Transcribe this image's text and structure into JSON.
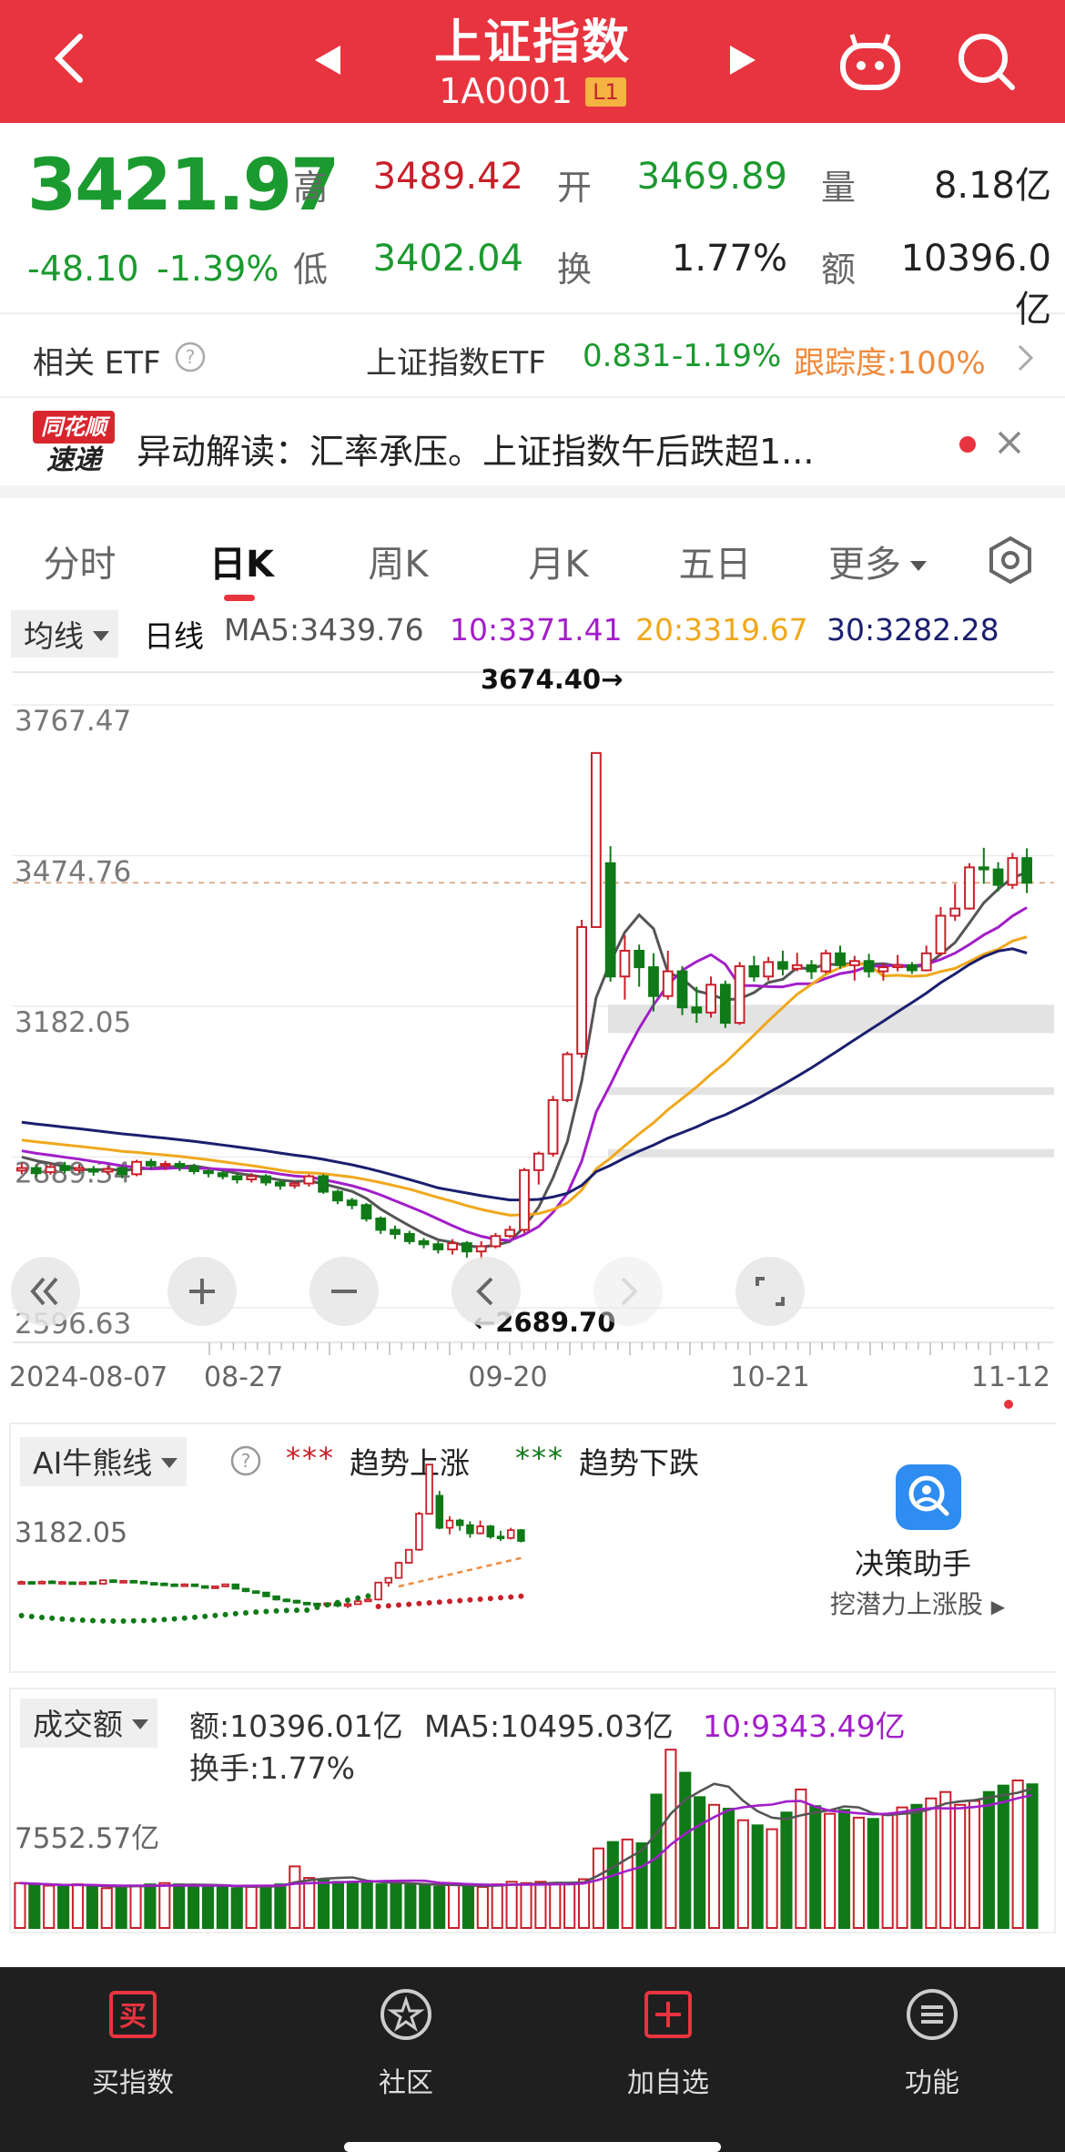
{
  "header": {
    "title": "上证指数",
    "code": "1A0001",
    "level_badge": "L1"
  },
  "quote": {
    "price": "3421.97",
    "change": "-48.10",
    "change_pct": "-1.39%",
    "high_label": "高",
    "high_value": "3489.42",
    "open_label": "开",
    "open_value": "3469.89",
    "volume_label": "量",
    "volume_value": "8.18亿",
    "low_label": "低",
    "low_value": "3402.04",
    "turnover_label": "换",
    "turnover_value": "1.77%",
    "amount_label": "额",
    "amount_value": "10396.0亿"
  },
  "etf": {
    "label": "相关 ETF",
    "name": "上证指数ETF",
    "price": "0.831",
    "change": "-1.19%",
    "tracking": "跟踪度:100%"
  },
  "news": {
    "logo_top": "同花顺",
    "logo_bottom": "速递",
    "text": "异动解读：汇率承压。上证指数午后跌超1..."
  },
  "tabs": [
    "分时",
    "日K",
    "周K",
    "月K",
    "五日",
    "更多"
  ],
  "ma_bar": {
    "selector": "均线",
    "period": "日线",
    "ma5": "MA5:3439.76",
    "ma10": "10:3371.41",
    "ma20": "20:3319.67",
    "ma30": "30:3282.28"
  },
  "colors": {
    "up": "#c8202a",
    "down": "#0f7a17",
    "ma5": "#555555",
    "ma10": "#a21ec9",
    "ma20": "#f0a81c",
    "ma30": "#1b1f6e"
  },
  "chart_data": {
    "type": "candlestick",
    "y_ticks": [
      "3767.47",
      "3474.76",
      "3182.05",
      "2889.34",
      "2596.63"
    ],
    "ylim": [
      2596.63,
      3767.47
    ],
    "x_labels": [
      "2024-08-07",
      "08-27",
      "09-20",
      "10-21",
      "11-12"
    ],
    "annotation_high": "3674.40→",
    "annotation_low": "←2689.70",
    "dashed_price": 3421.97,
    "candles": [
      [
        2863,
        2868,
        2878,
        2856
      ],
      [
        2868,
        2858,
        2874,
        2850
      ],
      [
        2860,
        2870,
        2878,
        2855
      ],
      [
        2872,
        2864,
        2880,
        2858
      ],
      [
        2864,
        2868,
        2875,
        2858
      ],
      [
        2866,
        2861,
        2872,
        2853
      ],
      [
        2861,
        2866,
        2872,
        2855
      ],
      [
        2868,
        2856,
        2872,
        2848
      ],
      [
        2856,
        2880,
        2884,
        2852
      ],
      [
        2880,
        2873,
        2886,
        2866
      ],
      [
        2873,
        2876,
        2882,
        2864
      ],
      [
        2876,
        2870,
        2882,
        2862
      ],
      [
        2870,
        2862,
        2876,
        2856
      ],
      [
        2862,
        2858,
        2866,
        2850
      ],
      [
        2858,
        2852,
        2864,
        2846
      ],
      [
        2852,
        2846,
        2858,
        2838
      ],
      [
        2846,
        2852,
        2858,
        2840
      ],
      [
        2852,
        2840,
        2856,
        2834
      ],
      [
        2840,
        2834,
        2846,
        2826
      ],
      [
        2834,
        2838,
        2844,
        2828
      ],
      [
        2838,
        2852,
        2856,
        2832
      ],
      [
        2852,
        2822,
        2856,
        2818
      ],
      [
        2822,
        2805,
        2826,
        2798
      ],
      [
        2805,
        2796,
        2810,
        2788
      ],
      [
        2796,
        2770,
        2800,
        2764
      ],
      [
        2770,
        2748,
        2774,
        2740
      ],
      [
        2748,
        2740,
        2756,
        2730
      ],
      [
        2740,
        2726,
        2746,
        2720
      ],
      [
        2726,
        2720,
        2732,
        2712
      ],
      [
        2720,
        2710,
        2726,
        2702
      ],
      [
        2710,
        2722,
        2730,
        2700
      ],
      [
        2722,
        2706,
        2726,
        2694
      ],
      [
        2706,
        2716,
        2726,
        2690
      ],
      [
        2716,
        2736,
        2742,
        2712
      ],
      [
        2736,
        2748,
        2756,
        2732
      ],
      [
        2748,
        2864,
        2868,
        2742
      ],
      [
        2864,
        2896,
        2900,
        2836
      ],
      [
        2896,
        3000,
        3008,
        2890
      ],
      [
        3000,
        3089,
        3094,
        2996
      ],
      [
        3090,
        3336,
        3350,
        3082
      ],
      [
        3336,
        3674,
        3674,
        3336
      ],
      [
        3460,
        3240,
        3493,
        3230
      ],
      [
        3240,
        3290,
        3320,
        3195
      ],
      [
        3290,
        3258,
        3302,
        3220
      ],
      [
        3258,
        3202,
        3285,
        3172
      ],
      [
        3202,
        3250,
        3290,
        3195
      ],
      [
        3250,
        3180,
        3260,
        3165
      ],
      [
        3180,
        3170,
        3220,
        3150
      ],
      [
        3170,
        3224,
        3240,
        3160
      ],
      [
        3224,
        3150,
        3232,
        3140
      ],
      [
        3150,
        3260,
        3268,
        3146
      ],
      [
        3260,
        3240,
        3280,
        3230
      ],
      [
        3240,
        3268,
        3278,
        3232
      ],
      [
        3268,
        3255,
        3290,
        3242
      ],
      [
        3255,
        3262,
        3286,
        3250
      ],
      [
        3262,
        3250,
        3272,
        3235
      ],
      [
        3250,
        3285,
        3292,
        3246
      ],
      [
        3285,
        3262,
        3300,
        3255
      ],
      [
        3262,
        3270,
        3280,
        3232
      ],
      [
        3270,
        3250,
        3284,
        3238
      ],
      [
        3250,
        3258,
        3266,
        3232
      ],
      [
        3258,
        3262,
        3282,
        3250
      ],
      [
        3262,
        3252,
        3268,
        3245
      ],
      [
        3252,
        3285,
        3300,
        3250
      ],
      [
        3285,
        3358,
        3375,
        3280
      ],
      [
        3358,
        3372,
        3420,
        3348
      ],
      [
        3372,
        3452,
        3460,
        3370
      ],
      [
        3452,
        3448,
        3490,
        3420
      ],
      [
        3448,
        3418,
        3462,
        3405
      ],
      [
        3418,
        3470,
        3480,
        3410
      ],
      [
        3470,
        3422,
        3489,
        3402
      ]
    ]
  },
  "controls": [
    "rewind-icon",
    "zoom-in-icon",
    "zoom-out-icon",
    "prev-icon",
    "next-icon",
    "fullscreen-icon"
  ],
  "ai": {
    "selector": "AI牛熊线",
    "up_label": "趋势上涨",
    "down_label": "趋势下跌",
    "price_label": "3182.05",
    "assistant_title": "决策助手",
    "assistant_sub": "挖潜力上涨股"
  },
  "volume": {
    "selector": "成交额",
    "amount": "额:10396.01亿",
    "ma5": "MA5:10495.03亿",
    "ma10": "10:9343.49亿",
    "turnover": "换手:1.77%",
    "y_tick": "7552.57亿",
    "bars": [
      3500,
      3400,
      3300,
      3200,
      3400,
      3300,
      3100,
      3200,
      3300,
      3400,
      3500,
      3400,
      3300,
      3200,
      3300,
      3100,
      3200,
      3300,
      3400,
      4800,
      3900,
      3800,
      3600,
      3600,
      3500,
      3400,
      3500,
      3400,
      3300,
      3200,
      3400,
      3300,
      3200,
      3400,
      3600,
      3500,
      3600,
      3500,
      3400,
      3800,
      6200,
      6700,
      6900,
      6600,
      10400,
      13900,
      12100,
      10200,
      9600,
      9300,
      8400,
      8000,
      7700,
      9000,
      10800,
      9500,
      8900,
      9200,
      8600,
      8500,
      8800,
      9400,
      9600,
      10100,
      10600,
      9600,
      9900,
      10600,
      11100,
      11500,
      11200
    ]
  },
  "bottom_nav": [
    {
      "label": "买指数",
      "icon": "buy-icon"
    },
    {
      "label": "社区",
      "icon": "community-icon"
    },
    {
      "label": "加自选",
      "icon": "add-watchlist-icon"
    },
    {
      "label": "功能",
      "icon": "menu-icon"
    }
  ]
}
